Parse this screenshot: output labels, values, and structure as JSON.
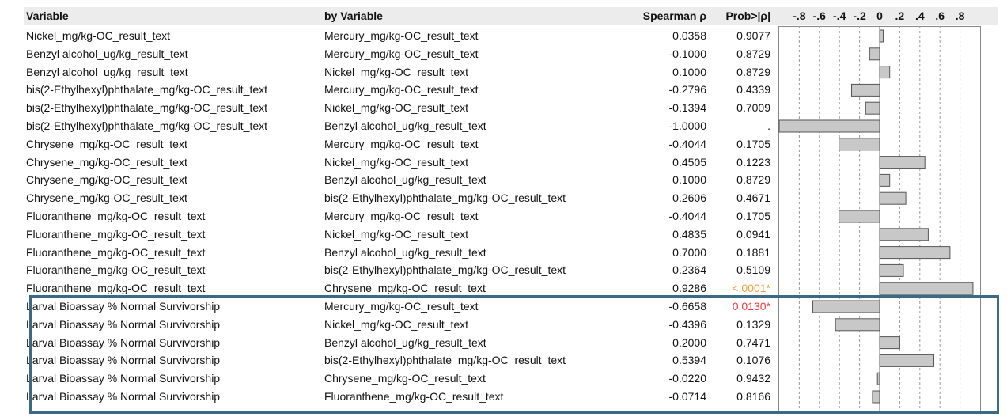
{
  "headers": {
    "variable": "Variable",
    "by_variable": "by Variable",
    "spearman": "Spearman ρ",
    "prob": "Prob>|ρ|"
  },
  "axis_ticks": [
    "-.8",
    "-.6",
    "-.4",
    "-.2",
    "0",
    ".2",
    ".4",
    ".6",
    ".8"
  ],
  "highlight_color": "#3b6a84",
  "significant_colors": {
    "red": "#f23a3a",
    "orange": "#f0a03a"
  },
  "rows": [
    {
      "variable": "Nickel_mg/kg-OC_result_text",
      "by": "Mercury_mg/kg-OC_result_text",
      "rho": "0.0358",
      "prob": "0.9077",
      "sig": ""
    },
    {
      "variable": "Benzyl alcohol_ug/kg_result_text",
      "by": "Mercury_mg/kg-OC_result_text",
      "rho": "-0.1000",
      "prob": "0.8729",
      "sig": ""
    },
    {
      "variable": "Benzyl alcohol_ug/kg_result_text",
      "by": "Nickel_mg/kg-OC_result_text",
      "rho": "0.1000",
      "prob": "0.8729",
      "sig": ""
    },
    {
      "variable": "bis(2-Ethylhexyl)phthalate_mg/kg-OC_result_text",
      "by": "Mercury_mg/kg-OC_result_text",
      "rho": "-0.2796",
      "prob": "0.4339",
      "sig": ""
    },
    {
      "variable": "bis(2-Ethylhexyl)phthalate_mg/kg-OC_result_text",
      "by": "Nickel_mg/kg-OC_result_text",
      "rho": "-0.1394",
      "prob": "0.7009",
      "sig": ""
    },
    {
      "variable": "bis(2-Ethylhexyl)phthalate_mg/kg-OC_result_text",
      "by": "Benzyl alcohol_ug/kg_result_text",
      "rho": "-1.0000",
      "prob": ".",
      "sig": ""
    },
    {
      "variable": "Chrysene_mg/kg-OC_result_text",
      "by": "Mercury_mg/kg-OC_result_text",
      "rho": "-0.4044",
      "prob": "0.1705",
      "sig": ""
    },
    {
      "variable": "Chrysene_mg/kg-OC_result_text",
      "by": "Nickel_mg/kg-OC_result_text",
      "rho": "0.4505",
      "prob": "0.1223",
      "sig": ""
    },
    {
      "variable": "Chrysene_mg/kg-OC_result_text",
      "by": "Benzyl alcohol_ug/kg_result_text",
      "rho": "0.1000",
      "prob": "0.8729",
      "sig": ""
    },
    {
      "variable": "Chrysene_mg/kg-OC_result_text",
      "by": "bis(2-Ethylhexyl)phthalate_mg/kg-OC_result_text",
      "rho": "0.2606",
      "prob": "0.4671",
      "sig": ""
    },
    {
      "variable": "Fluoranthene_mg/kg-OC_result_text",
      "by": "Mercury_mg/kg-OC_result_text",
      "rho": "-0.4044",
      "prob": "0.1705",
      "sig": ""
    },
    {
      "variable": "Fluoranthene_mg/kg-OC_result_text",
      "by": "Nickel_mg/kg-OC_result_text",
      "rho": "0.4835",
      "prob": "0.0941",
      "sig": ""
    },
    {
      "variable": "Fluoranthene_mg/kg-OC_result_text",
      "by": "Benzyl alcohol_ug/kg_result_text",
      "rho": "0.7000",
      "prob": "0.1881",
      "sig": ""
    },
    {
      "variable": "Fluoranthene_mg/kg-OC_result_text",
      "by": "bis(2-Ethylhexyl)phthalate_mg/kg-OC_result_text",
      "rho": "0.2364",
      "prob": "0.5109",
      "sig": ""
    },
    {
      "variable": "Fluoranthene_mg/kg-OC_result_text",
      "by": "Chrysene_mg/kg-OC_result_text",
      "rho": "0.9286",
      "prob": "<.0001*",
      "sig": "orange"
    },
    {
      "variable": "Larval Bioassay % Normal Survivorship",
      "by": "Mercury_mg/kg-OC_result_text",
      "rho": "-0.6658",
      "prob": "0.0130*",
      "sig": "red"
    },
    {
      "variable": "Larval Bioassay % Normal Survivorship",
      "by": "Nickel_mg/kg-OC_result_text",
      "rho": "-0.4396",
      "prob": "0.1329",
      "sig": ""
    },
    {
      "variable": "Larval Bioassay % Normal Survivorship",
      "by": "Benzyl alcohol_ug/kg_result_text",
      "rho": "0.2000",
      "prob": "0.7471",
      "sig": ""
    },
    {
      "variable": "Larval Bioassay % Normal Survivorship",
      "by": "bis(2-Ethylhexyl)phthalate_mg/kg-OC_result_text",
      "rho": "0.5394",
      "prob": "0.1076",
      "sig": ""
    },
    {
      "variable": "Larval Bioassay % Normal Survivorship",
      "by": "Chrysene_mg/kg-OC_result_text",
      "rho": "-0.0220",
      "prob": "0.9432",
      "sig": ""
    },
    {
      "variable": "Larval Bioassay % Normal Survivorship",
      "by": "Fluoranthene_mg/kg-OC_result_text",
      "rho": "-0.0714",
      "prob": "0.8166",
      "sig": ""
    }
  ],
  "chart_data": {
    "type": "bar",
    "orientation": "horizontal",
    "xlim": [
      -1,
      1
    ],
    "ticks": [
      -0.8,
      -0.6,
      -0.4,
      -0.2,
      0,
      0.2,
      0.4,
      0.6,
      0.8
    ],
    "values": [
      0.0358,
      -0.1,
      0.1,
      -0.2796,
      -0.1394,
      -1.0,
      -0.4044,
      0.4505,
      0.1,
      0.2606,
      -0.4044,
      0.4835,
      0.7,
      0.2364,
      0.9286,
      -0.6658,
      -0.4396,
      0.2,
      0.5394,
      -0.022,
      -0.0714
    ],
    "grid": true
  }
}
